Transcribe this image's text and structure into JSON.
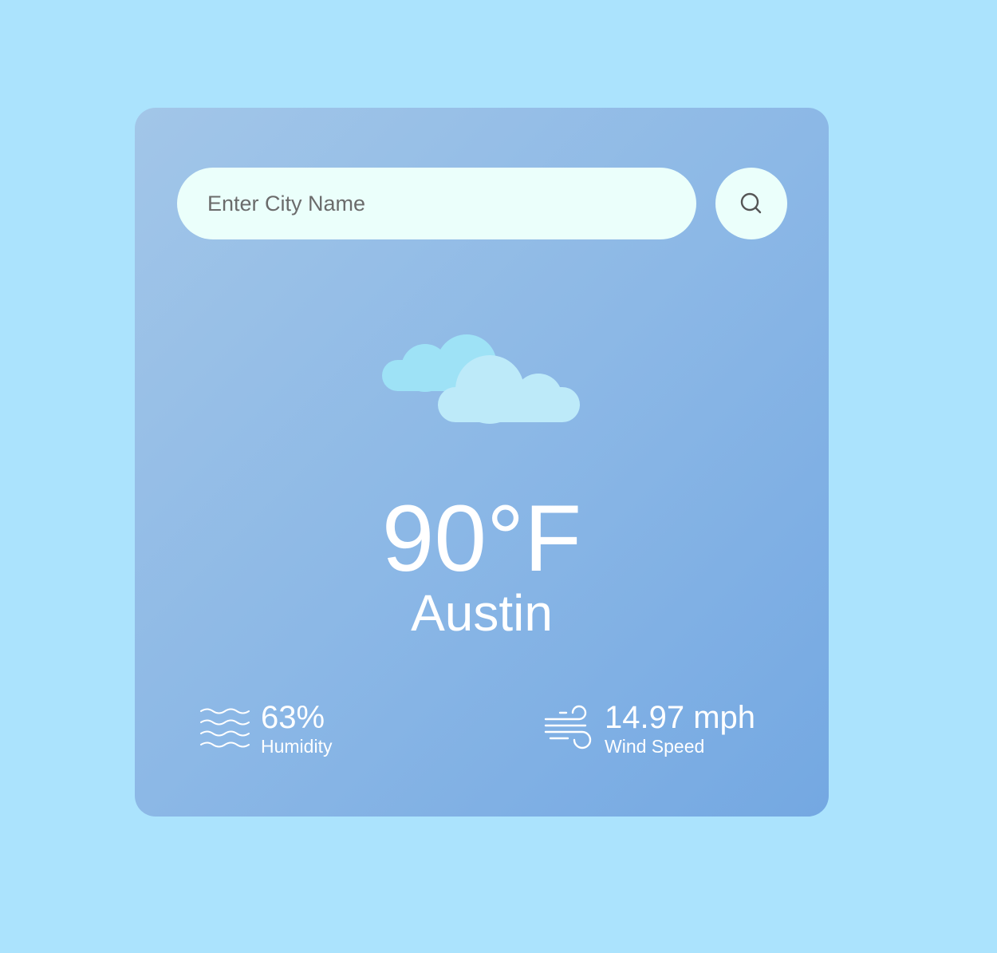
{
  "search": {
    "placeholder": "Enter City Name",
    "value": "",
    "button_icon": "search-icon"
  },
  "weather": {
    "icon": "clouds-icon",
    "temperature": "90°F",
    "city": "Austin"
  },
  "details": {
    "humidity": {
      "icon": "humidity-waves-icon",
      "value": "63%",
      "label": "Humidity"
    },
    "wind": {
      "icon": "wind-icon",
      "value": "14.97 mph",
      "label": "Wind Speed"
    }
  },
  "colors": {
    "background": "#abe3fd",
    "card_gradient_start": "#a2c6e8",
    "card_gradient_end": "#74a8e2",
    "input_background": "#ebfffb",
    "text": "#ffffff",
    "cloud_back": "#9ee2f6",
    "cloud_front": "#bdeaf9"
  }
}
